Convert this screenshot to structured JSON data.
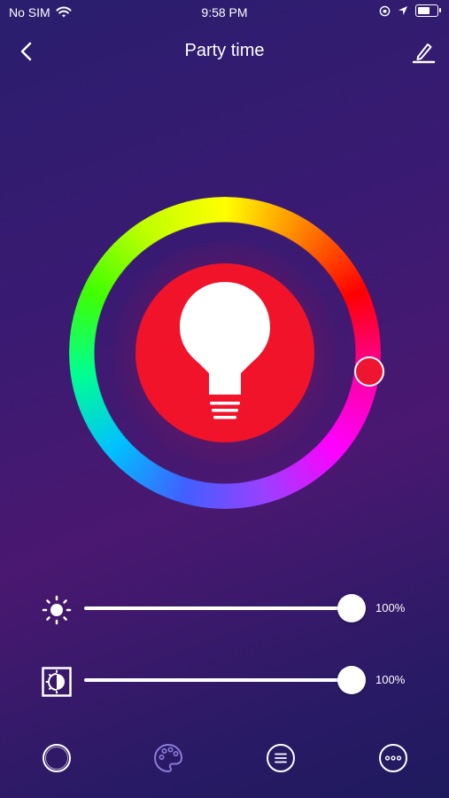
{
  "status_bar": {
    "carrier": "No SIM",
    "time": "9:58 PM",
    "battery_level": 0.7
  },
  "nav": {
    "title": "Party time",
    "back_icon": "chevron-left-icon",
    "edit_icon": "pencil-icon"
  },
  "color_wheel": {
    "selected_color": "#ee1530",
    "bulb_color": "#f0132a",
    "hue_degrees": 0
  },
  "brightness": {
    "icon": "sun-icon",
    "value": "100%",
    "level": 1.0
  },
  "temperature": {
    "icon": "contrast-icon",
    "value": "100%",
    "level": 1.0
  },
  "tabs": [
    {
      "icon": "circle-icon",
      "active": false
    },
    {
      "icon": "palette-icon",
      "active": true,
      "color": "#8a7cd8"
    },
    {
      "icon": "list-icon",
      "active": false
    },
    {
      "icon": "more-icon",
      "active": false
    }
  ]
}
